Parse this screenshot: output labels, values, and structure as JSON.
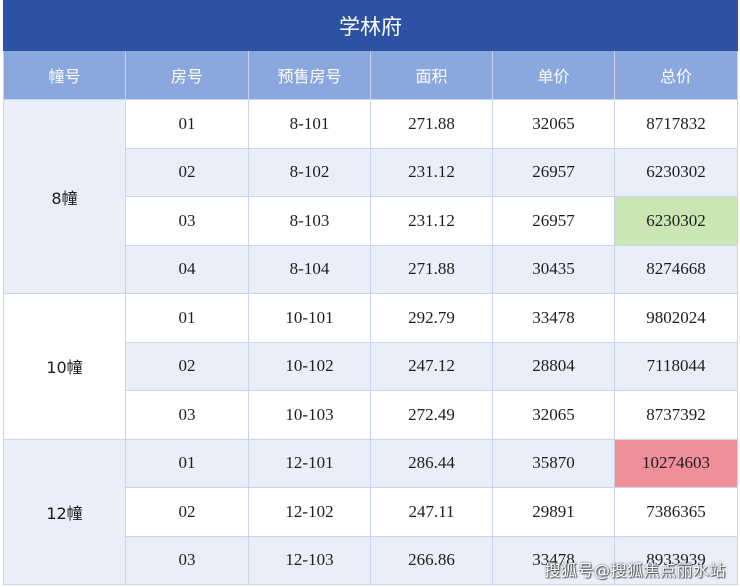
{
  "title": "学林府",
  "headers": [
    "幢号",
    "房号",
    "预售房号",
    "面积",
    "单价",
    "总价"
  ],
  "buildings": [
    {
      "name": "8幢",
      "rows": [
        {
          "room": "01",
          "presale": "8-101",
          "area": "271.88",
          "unit_price": "32065",
          "total": "8717832"
        },
        {
          "room": "02",
          "presale": "8-102",
          "area": "231.12",
          "unit_price": "26957",
          "total": "6230302"
        },
        {
          "room": "03",
          "presale": "8-103",
          "area": "231.12",
          "unit_price": "26957",
          "total": "6230302"
        },
        {
          "room": "04",
          "presale": "8-104",
          "area": "271.88",
          "unit_price": "30435",
          "total": "8274668"
        }
      ]
    },
    {
      "name": "10幢",
      "rows": [
        {
          "room": "01",
          "presale": "10-101",
          "area": "292.79",
          "unit_price": "33478",
          "total": "9802024"
        },
        {
          "room": "02",
          "presale": "10-102",
          "area": "247.12",
          "unit_price": "28804",
          "total": "7118044"
        },
        {
          "room": "03",
          "presale": "10-103",
          "area": "272.49",
          "unit_price": "32065",
          "total": "8737392"
        }
      ]
    },
    {
      "name": "12幢",
      "rows": [
        {
          "room": "01",
          "presale": "12-101",
          "area": "286.44",
          "unit_price": "35870",
          "total": "10274603"
        },
        {
          "room": "02",
          "presale": "12-102",
          "area": "247.11",
          "unit_price": "29891",
          "total": "7386365"
        },
        {
          "room": "03",
          "presale": "12-103",
          "area": "266.86",
          "unit_price": "33478",
          "total": "8933939"
        }
      ]
    }
  ],
  "highlight_colors": {
    "green": "#c9e6b3",
    "red": "#ef8f9a"
  },
  "watermark": "搜狐号@搜狐焦点丽水站"
}
